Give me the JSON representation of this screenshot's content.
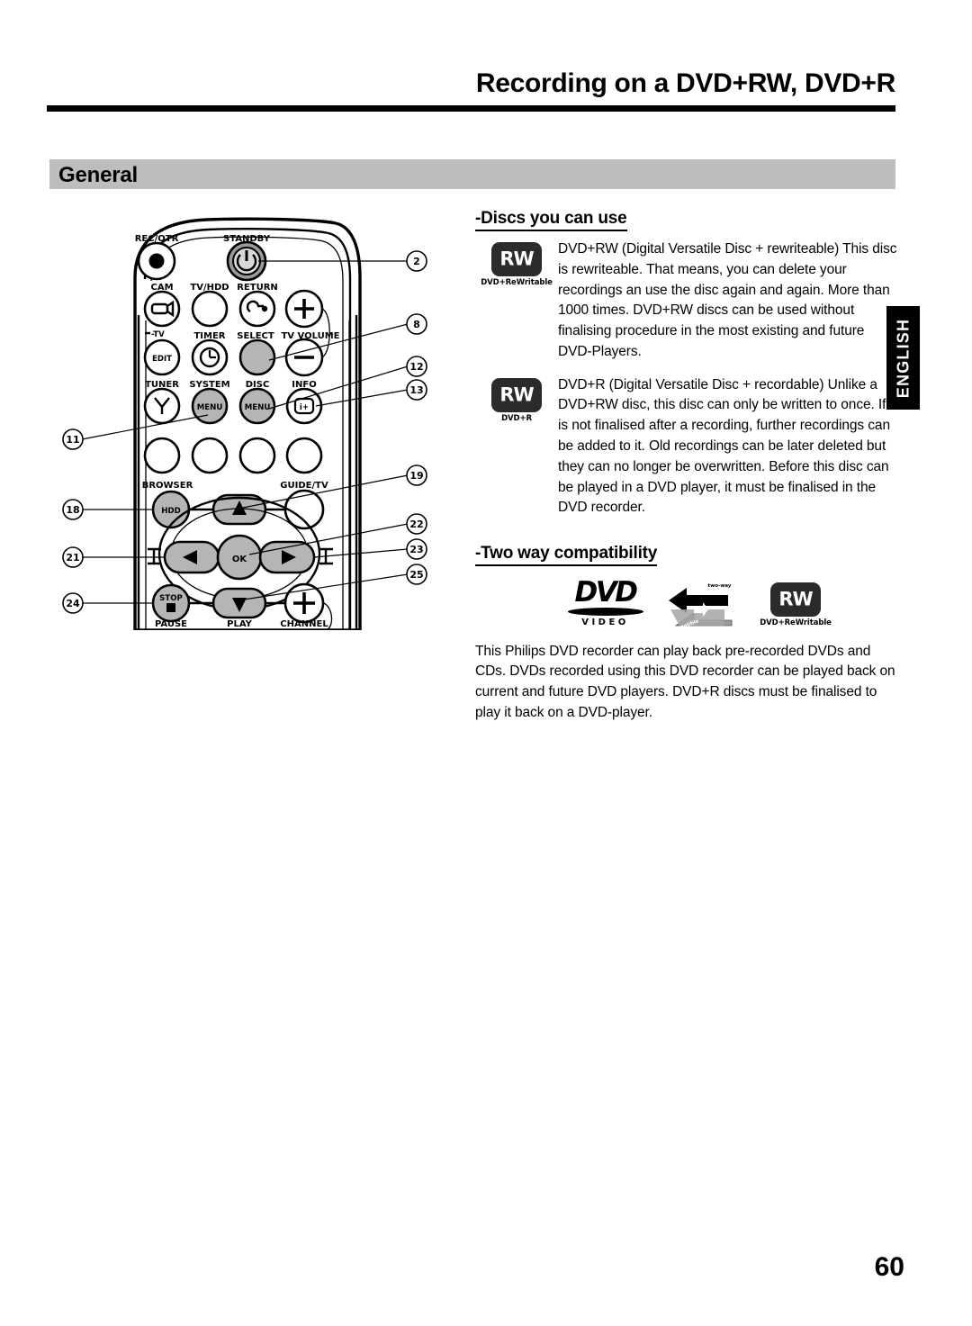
{
  "header": {
    "title": "Recording on a DVD+RW, DVD+R"
  },
  "section": {
    "banner_label": "General"
  },
  "side_tab": {
    "label": "ENGLISH"
  },
  "content": {
    "discs_heading": "-Discs you can use",
    "dvdrw": {
      "logo_text": "RW",
      "logo_caption": "DVD+ReWritable",
      "body": "DVD+RW (Digital Versatile Disc + rewriteable) This disc is rewriteable. That means, you can delete your recordings an use the disc again and again. More than 1000 times. DVD+RW discs can be used without finalising procedure in the most existing and future DVD-Players."
    },
    "dvdr": {
      "logo_text": "RW",
      "logo_caption": "DVD+R",
      "body": "DVD+R (Digital Versatile Disc + recordable) Unlike a DVD+RW disc, this disc can only be written to once. If it is not finalised after a recording, further recordings can be added to it. Old recordings can be later deleted but they can no longer be overwritten. Before this disc can be played in a DVD player, it must be finalised in the DVD recorder."
    },
    "compat_heading": "-Two way compatibility",
    "compat_logos": {
      "dvd_word": "DVD",
      "dvd_sub": "VIDEO",
      "twoway_top": "two-way",
      "twoway_bottom": "compatible",
      "rw_text": "RW",
      "rw_caption": "DVD+ReWritable"
    },
    "compat_body": "This Philips DVD recorder can play back pre-recorded DVDs and CDs. DVDs recorded using this DVD recorder can be played back on current and future DVD players. DVD+R discs must be finalised to play it back on a DVD-player."
  },
  "remote": {
    "side_label": "-TV",
    "button_labels": {
      "rec_otr": "REC/OTR",
      "standby": "STANDBY",
      "cam": "CAM",
      "tv_hdd": "TV/HDD",
      "return": "RETURN",
      "timer": "TIMER",
      "select": "SELECT",
      "tv_volume": "TV VOLUME",
      "edit": "EDIT",
      "tuner": "TUNER",
      "system": "SYSTEM",
      "system_menu": "MENU",
      "disc": "DISC",
      "disc_menu": "MENU",
      "info": "INFO",
      "info_glyph": "i+",
      "browser": "BROWSER",
      "hdd": "HDD",
      "guide_tv": "GUIDE/TV",
      "ok": "OK",
      "stop": "STOP",
      "pause": "PAUSE",
      "play": "PLAY",
      "channel": "CHANNEL"
    },
    "callouts_left": [
      "11",
      "18",
      "21",
      "24"
    ],
    "callouts_right": [
      "2",
      "8",
      "12",
      "13",
      "19",
      "22",
      "23",
      "25"
    ]
  },
  "footer": {
    "page_number": "60"
  },
  "colors": {
    "banner_gray": "#bdbdbd",
    "button_gray": "#b5b5b5",
    "badge_dark": "#2b2b2b",
    "ink": "#000000"
  }
}
